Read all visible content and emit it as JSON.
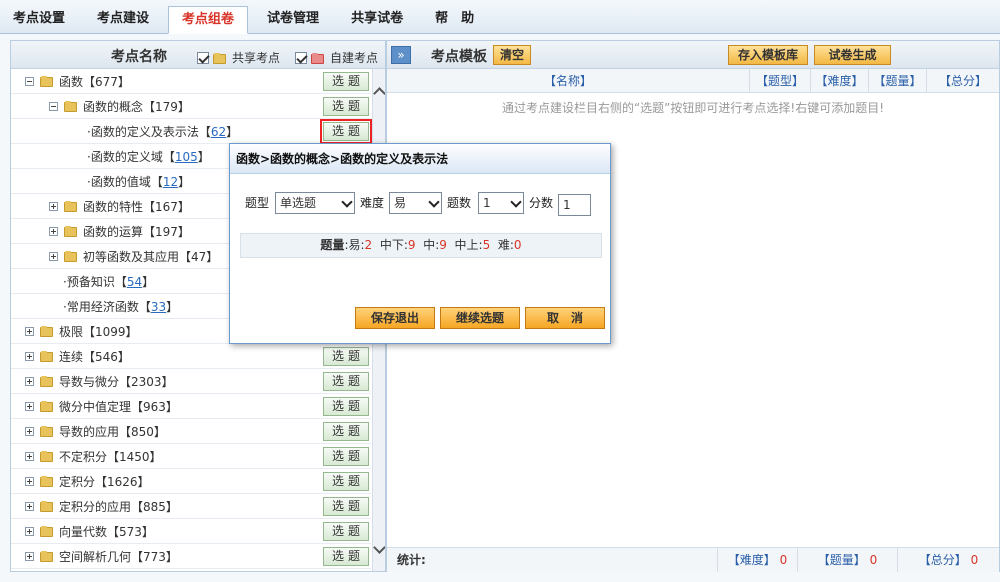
{
  "tabs": [
    "考点设置",
    "考点建设",
    "考点组卷",
    "试卷管理",
    "共享试卷",
    "帮　助"
  ],
  "active_tab": "考点组卷",
  "left_panel": {
    "title": "考点名称",
    "legend_shared": "共享考点",
    "legend_own": "自建考点",
    "pick_label": "选题",
    "rows": [
      {
        "label": "函数【677】",
        "count": "",
        "expander": "minus"
      },
      {
        "label": "函数的概念【179】",
        "count": "",
        "expander": "minus"
      },
      {
        "label": "·函数的定义及表示法【",
        "count": "62",
        "tail": "】"
      },
      {
        "label": "·函数的定义域【",
        "count": "105",
        "tail": "】"
      },
      {
        "label": "·函数的值域【",
        "count": "12",
        "tail": "】"
      },
      {
        "label": "函数的特性【167】",
        "count": "",
        "expander": "plus"
      },
      {
        "label": "函数的运算【197】",
        "count": "",
        "expander": "plus"
      },
      {
        "label": "初等函数及其应用【47】",
        "count": "",
        "expander": "plus"
      },
      {
        "label": "·预备知识【",
        "count": "54",
        "tail": "】"
      },
      {
        "label": "·常用经济函数【",
        "count": "33",
        "tail": "】"
      },
      {
        "label": "极限【1099】",
        "count": "",
        "expander": "plus"
      },
      {
        "label": "连续【546】",
        "count": "",
        "expander": "plus"
      },
      {
        "label": "导数与微分【2303】",
        "count": "",
        "expander": "plus"
      },
      {
        "label": "微分中值定理【963】",
        "count": "",
        "expander": "plus"
      },
      {
        "label": "导数的应用【850】",
        "count": "",
        "expander": "plus"
      },
      {
        "label": "不定积分【1450】",
        "count": "",
        "expander": "plus"
      },
      {
        "label": "定积分【1626】",
        "count": "",
        "expander": "plus"
      },
      {
        "label": "定积分的应用【885】",
        "count": "",
        "expander": "plus"
      },
      {
        "label": "向量代数【573】",
        "count": "",
        "expander": "plus"
      },
      {
        "label": "空间解析几何【773】",
        "count": "",
        "expander": "plus"
      }
    ]
  },
  "right_panel": {
    "collapse_label": "»",
    "title": "考点模板",
    "clear_label": "清空",
    "save_template_label": "存入模板库",
    "generate_label": "试卷生成",
    "columns": [
      "【名称】",
      "【题型】",
      "【难度】",
      "【题量】",
      "【总分】"
    ],
    "hint": "通过考点建设栏目右侧的“选题”按钮即可进行考点选择!右键可添加题目!",
    "footer_label": "统计:",
    "footer_difficulty": "【难度】",
    "footer_quantity": "【题量】",
    "footer_total": "【总分】",
    "footer_value": "0"
  },
  "dialog": {
    "title": "函数>函数的概念>函数的定义及表示法",
    "type_label": "题型",
    "type_value": "单选题",
    "difficulty_label": "难度",
    "difficulty_value": "易",
    "count_label": "题数",
    "count_value": "1",
    "score_label": "分数",
    "score_value": "1",
    "stats_label": "题量",
    "stats": [
      {
        "label": "易",
        "value": "2"
      },
      {
        "label": "中下",
        "value": "9"
      },
      {
        "label": "中",
        "value": "9"
      },
      {
        "label": "中上",
        "value": "5"
      },
      {
        "label": "难",
        "value": "0"
      }
    ],
    "save_exit_label": "保存退出",
    "continue_label": "继续选题",
    "cancel_label": "取　消"
  }
}
